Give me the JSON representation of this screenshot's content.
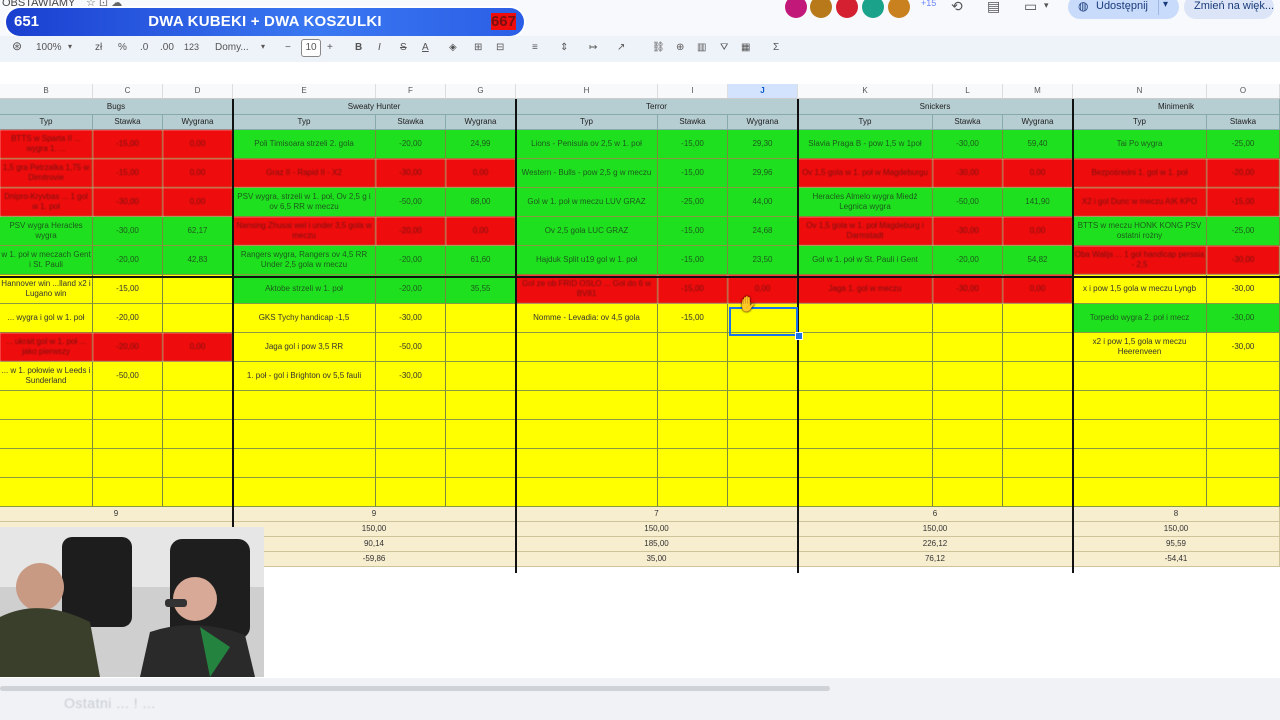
{
  "app": {
    "doc_title": "OBSTAWIAMY",
    "title_icons": "☆ ⊡ ☁"
  },
  "banner": {
    "left": "651",
    "center": "DWA KUBEKI + DWA KOSZULKI",
    "right": "667"
  },
  "topbar": {
    "plus_count": "+15",
    "share_label": "Udostępnij",
    "change_label": "Zmień na więk..."
  },
  "toolbar": {
    "zoom": "100%",
    "currency": "zł",
    "percent": "%",
    "dec_minus": ".0",
    "dec_plus": ".00",
    "number_format": "123",
    "font": "Domy...",
    "font_size": "10",
    "bold": "B",
    "italic": "I",
    "strike": "S",
    "text_color": "A"
  },
  "columns": [
    {
      "id": "B",
      "label": "B"
    },
    {
      "id": "C",
      "label": "C"
    },
    {
      "id": "D",
      "label": "D"
    },
    {
      "id": "E",
      "label": "E"
    },
    {
      "id": "F",
      "label": "F"
    },
    {
      "id": "G",
      "label": "G"
    },
    {
      "id": "H",
      "label": "H"
    },
    {
      "id": "I",
      "label": "I"
    },
    {
      "id": "J",
      "label": "J"
    },
    {
      "id": "K",
      "label": "K"
    },
    {
      "id": "L",
      "label": "L"
    },
    {
      "id": "M",
      "label": "M"
    },
    {
      "id": "N",
      "label": "N"
    },
    {
      "id": "O",
      "label": "O"
    }
  ],
  "players": [
    "Bugs",
    "Sweaty Hunter",
    "Terror",
    "Snickers",
    "Minimenik"
  ],
  "subheaders": {
    "typ": "Typ",
    "stawka": "Stawka",
    "wygrana": "Wygrana"
  },
  "rows": [
    [
      [
        "r",
        "BTTS w Sparta II ... wygra 1. ..."
      ],
      [
        "r",
        "-15,00"
      ],
      [
        "r",
        "0,00"
      ],
      [
        "g",
        "Poli Timisoara strzeli 2. gola"
      ],
      [
        "g",
        "-20,00"
      ],
      [
        "g",
        "24,99"
      ],
      [
        "g",
        "Lions - Penisula ov 2,5 w 1. poł"
      ],
      [
        "g",
        "-15,00"
      ],
      [
        "g",
        "29,30"
      ],
      [
        "g",
        "Slavia Praga B - pow 1,5 w 1poł"
      ],
      [
        "g",
        "-30,00"
      ],
      [
        "g",
        "59,40"
      ],
      [
        "g",
        "Tai Po wygra"
      ],
      [
        "g",
        "-25,00"
      ]
    ],
    [
      [
        "r",
        "1,5 gra Petrzalka 1,75 w Dimitrovie"
      ],
      [
        "r",
        "-15,00"
      ],
      [
        "r",
        "0,00"
      ],
      [
        "r",
        "Graz II - Rapid II - X2"
      ],
      [
        "r",
        "-30,00"
      ],
      [
        "r",
        "0,00"
      ],
      [
        "g",
        "Western - Bulls - pow 2,5 g w meczu"
      ],
      [
        "g",
        "-15,00"
      ],
      [
        "g",
        "29,96"
      ],
      [
        "r",
        "Ov 1,5 gola w 1. poł w Magdeburgu"
      ],
      [
        "r",
        "-30,00"
      ],
      [
        "r",
        "0,00"
      ],
      [
        "r",
        "Bezpośredni 1. gol w 1. poł"
      ],
      [
        "r",
        "-20,00"
      ]
    ],
    [
      [
        "r",
        "Dnipro-Kryvbas ... 1 gol w 1. poł"
      ],
      [
        "r",
        "-30,00"
      ],
      [
        "r",
        "0,00"
      ],
      [
        "g",
        "PSV wygra, strzeli w 1. poł, Ov 2,5 g i ov 6,5 RR w meczu"
      ],
      [
        "g",
        "-50,00"
      ],
      [
        "g",
        "88,00"
      ],
      [
        "g",
        "Gol w 1. poł w meczu LUV GRAZ"
      ],
      [
        "g",
        "-25,00"
      ],
      [
        "g",
        "44,00"
      ],
      [
        "g",
        "Heracles Almelo wygra Miedź Legnica wygra"
      ],
      [
        "g",
        "-50,00"
      ],
      [
        "g",
        "141,90"
      ],
      [
        "r",
        "X2 i gol Dunc w meczu AIK KPO"
      ],
      [
        "r",
        "-15,00"
      ]
    ],
    [
      [
        "g",
        "PSV wygra Heracles wygra"
      ],
      [
        "g",
        "-30,00"
      ],
      [
        "g",
        "62,17"
      ],
      [
        "r",
        "Nansing Zhusai wel i under 3,5 gola w meczu"
      ],
      [
        "r",
        "-20,00"
      ],
      [
        "r",
        "0,00"
      ],
      [
        "g",
        "Ov 2,5 gola LUC GRAZ"
      ],
      [
        "g",
        "-15,00"
      ],
      [
        "g",
        "24,68"
      ],
      [
        "r",
        "Ov 1,5 gola w 1. poł Magdeburg i Darmstadt"
      ],
      [
        "r",
        "-30,00"
      ],
      [
        "r",
        "0,00"
      ],
      [
        "g",
        "BTTS w meczu HONK KONG PSV ostatni rożny"
      ],
      [
        "g",
        "-25,00"
      ]
    ],
    [
      [
        "g",
        "w 1. poł w meczach Gent i St. Pauli"
      ],
      [
        "g",
        "-20,00"
      ],
      [
        "g",
        "42,83"
      ],
      [
        "g",
        "Rangers wygra, Rangers ov 4,5 RR Under 2,5 gola w meczu"
      ],
      [
        "g",
        "-20,00"
      ],
      [
        "g",
        "61,60"
      ],
      [
        "g",
        "Hajduk Split u19 gol w 1. poł"
      ],
      [
        "g",
        "-15,00"
      ],
      [
        "g",
        "23,50"
      ],
      [
        "g",
        "Gol w 1. poł w St. Pauli i Gent"
      ],
      [
        "g",
        "-20,00"
      ],
      [
        "g",
        "54,82"
      ],
      [
        "r",
        "Oba Walijs ... 1 gol handicap perssia - 2,5"
      ],
      [
        "r",
        "-30,00"
      ]
    ],
    [
      [
        "y",
        "Hannover win ...lland x2 i Lugano win"
      ],
      [
        "y",
        "-15,00"
      ],
      [
        "y",
        ""
      ],
      [
        "g",
        "Aktobe strzeli w 1. poł"
      ],
      [
        "g",
        "-20,00"
      ],
      [
        "g",
        "35,55"
      ],
      [
        "r",
        "Gol ze ob FRID OSLO ... Gol do 6 w BV81"
      ],
      [
        "r",
        "-15,00"
      ],
      [
        "r",
        "0,00"
      ],
      [
        "r",
        "Jaga 1. gol w meczu"
      ],
      [
        "r",
        "-30,00"
      ],
      [
        "r",
        "0,00"
      ],
      [
        "y",
        "x i pow 1,5 gola w meczu Lyngb"
      ],
      [
        "y",
        "-30,00"
      ]
    ],
    [
      [
        "y",
        "... wygra i gol w 1. poł"
      ],
      [
        "y",
        "-20,00"
      ],
      [
        "y",
        ""
      ],
      [
        "y",
        "GKS Tychy handicap -1,5"
      ],
      [
        "y",
        "-30,00"
      ],
      [
        "y",
        ""
      ],
      [
        "y",
        "Nomme - Levadia: ov 4,5 gola"
      ],
      [
        "y",
        "-15,00"
      ],
      [
        "y",
        ""
      ],
      [
        "y",
        ""
      ],
      [
        "y",
        ""
      ],
      [
        "y",
        ""
      ],
      [
        "g",
        "Torpedo wygra 2. poł i mecz"
      ],
      [
        "g",
        "-30,00"
      ]
    ],
    [
      [
        "r",
        "... ukrait gol w 1. poł ... jako pierwszy"
      ],
      [
        "r",
        "-20,00"
      ],
      [
        "r",
        "0,00"
      ],
      [
        "y",
        "Jaga gol i pow 3,5 RR"
      ],
      [
        "y",
        "-50,00"
      ],
      [
        "y",
        ""
      ],
      [
        "y",
        ""
      ],
      [
        "y",
        ""
      ],
      [
        "y",
        ""
      ],
      [
        "y",
        ""
      ],
      [
        "y",
        ""
      ],
      [
        "y",
        ""
      ],
      [
        "y",
        "x2 i pow 1,5 gola w meczu Heerenveen"
      ],
      [
        "y",
        "-30,00"
      ]
    ],
    [
      [
        "y",
        "... w 1. połowie w Leeds i Sunderland"
      ],
      [
        "y",
        "-50,00"
      ],
      [
        "y",
        ""
      ],
      [
        "y",
        "1. poł - gol i Brighton ov 5,5 fauli"
      ],
      [
        "y",
        "-30,00"
      ],
      [
        "y",
        ""
      ],
      [
        "y",
        ""
      ],
      [
        "y",
        ""
      ],
      [
        "y",
        ""
      ],
      [
        "y",
        ""
      ],
      [
        "y",
        ""
      ],
      [
        "y",
        ""
      ],
      [
        "y",
        ""
      ],
      [
        "y",
        ""
      ]
    ],
    [
      [
        "y",
        ""
      ],
      [
        "y",
        ""
      ],
      [
        "y",
        ""
      ],
      [
        "y",
        ""
      ],
      [
        "y",
        ""
      ],
      [
        "y",
        ""
      ],
      [
        "y",
        ""
      ],
      [
        "y",
        ""
      ],
      [
        "y",
        ""
      ],
      [
        "y",
        ""
      ],
      [
        "y",
        ""
      ],
      [
        "y",
        ""
      ],
      [
        "y",
        ""
      ],
      [
        "y",
        ""
      ]
    ],
    [
      [
        "y",
        ""
      ],
      [
        "y",
        ""
      ],
      [
        "y",
        ""
      ],
      [
        "y",
        ""
      ],
      [
        "y",
        ""
      ],
      [
        "y",
        ""
      ],
      [
        "y",
        ""
      ],
      [
        "y",
        ""
      ],
      [
        "y",
        ""
      ],
      [
        "y",
        ""
      ],
      [
        "y",
        ""
      ],
      [
        "y",
        ""
      ],
      [
        "y",
        ""
      ],
      [
        "y",
        ""
      ]
    ],
    [
      [
        "y",
        ""
      ],
      [
        "y",
        ""
      ],
      [
        "y",
        ""
      ],
      [
        "y",
        ""
      ],
      [
        "y",
        ""
      ],
      [
        "y",
        ""
      ],
      [
        "y",
        ""
      ],
      [
        "y",
        ""
      ],
      [
        "y",
        ""
      ],
      [
        "y",
        ""
      ],
      [
        "y",
        ""
      ],
      [
        "y",
        ""
      ],
      [
        "y",
        ""
      ],
      [
        "y",
        ""
      ]
    ],
    [
      [
        "y",
        ""
      ],
      [
        "y",
        ""
      ],
      [
        "y",
        ""
      ],
      [
        "y",
        ""
      ],
      [
        "y",
        ""
      ],
      [
        "y",
        ""
      ],
      [
        "y",
        ""
      ],
      [
        "y",
        ""
      ],
      [
        "y",
        ""
      ],
      [
        "y",
        ""
      ],
      [
        "y",
        ""
      ],
      [
        "y",
        ""
      ],
      [
        "y",
        ""
      ],
      [
        "y",
        ""
      ]
    ]
  ],
  "summary": [
    [
      "9",
      "9",
      "7",
      "6",
      "8"
    ],
    [
      "",
      "150,00",
      "150,00",
      "150,00",
      "150,00"
    ],
    [
      "",
      "90,14",
      "185,00",
      "226,12",
      "95,59"
    ],
    [
      "",
      "-59,86",
      "35,00",
      "76,12",
      "-54,41"
    ]
  ],
  "caption": "Ostatni ... ! ..."
}
